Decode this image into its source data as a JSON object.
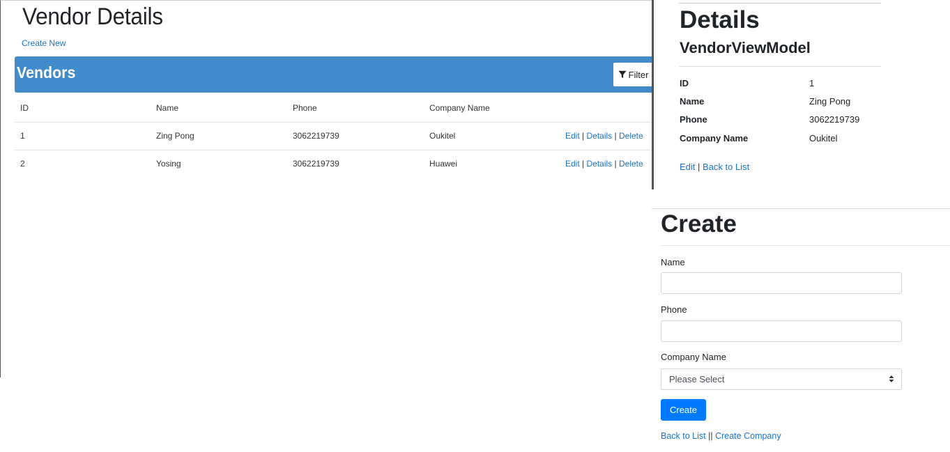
{
  "vendor_page": {
    "title": "Vendor Details",
    "create_new_link": "Create New",
    "panel_title": "Vendors",
    "filter_button": "Filter",
    "table": {
      "columns": [
        "ID",
        "Name",
        "Phone",
        "Company Name"
      ],
      "rows": [
        {
          "id": "1",
          "name": "Zing Pong",
          "phone": "3062219739",
          "company": "Oukitel"
        },
        {
          "id": "2",
          "name": "Yosing",
          "phone": "3062219739",
          "company": "Huawei"
        }
      ],
      "actions": {
        "edit": "Edit",
        "details": "Details",
        "delete": "Delete",
        "separator": "|"
      }
    }
  },
  "details_page": {
    "title": "Details",
    "subtitle": "VendorViewModel",
    "fields": [
      {
        "label": "ID",
        "value": "1"
      },
      {
        "label": "Name",
        "value": "Zing Pong"
      },
      {
        "label": "Phone",
        "value": "3062219739"
      },
      {
        "label": "Company Name",
        "value": "Oukitel"
      }
    ],
    "links": {
      "edit": "Edit",
      "separator": "|",
      "back": "Back to List"
    }
  },
  "create_page": {
    "title": "Create",
    "name_label": "Name",
    "name_value": "",
    "phone_label": "Phone",
    "phone_value": "",
    "company_label": "Company Name",
    "company_selected": "Please Select",
    "submit_button": "Create",
    "links": {
      "back": "Back to List",
      "separator": "||",
      "create_company": "Create Company"
    }
  },
  "colors": {
    "header_blue": "#428bca",
    "link_blue": "#1a73c8",
    "primary_button": "#007bff"
  }
}
